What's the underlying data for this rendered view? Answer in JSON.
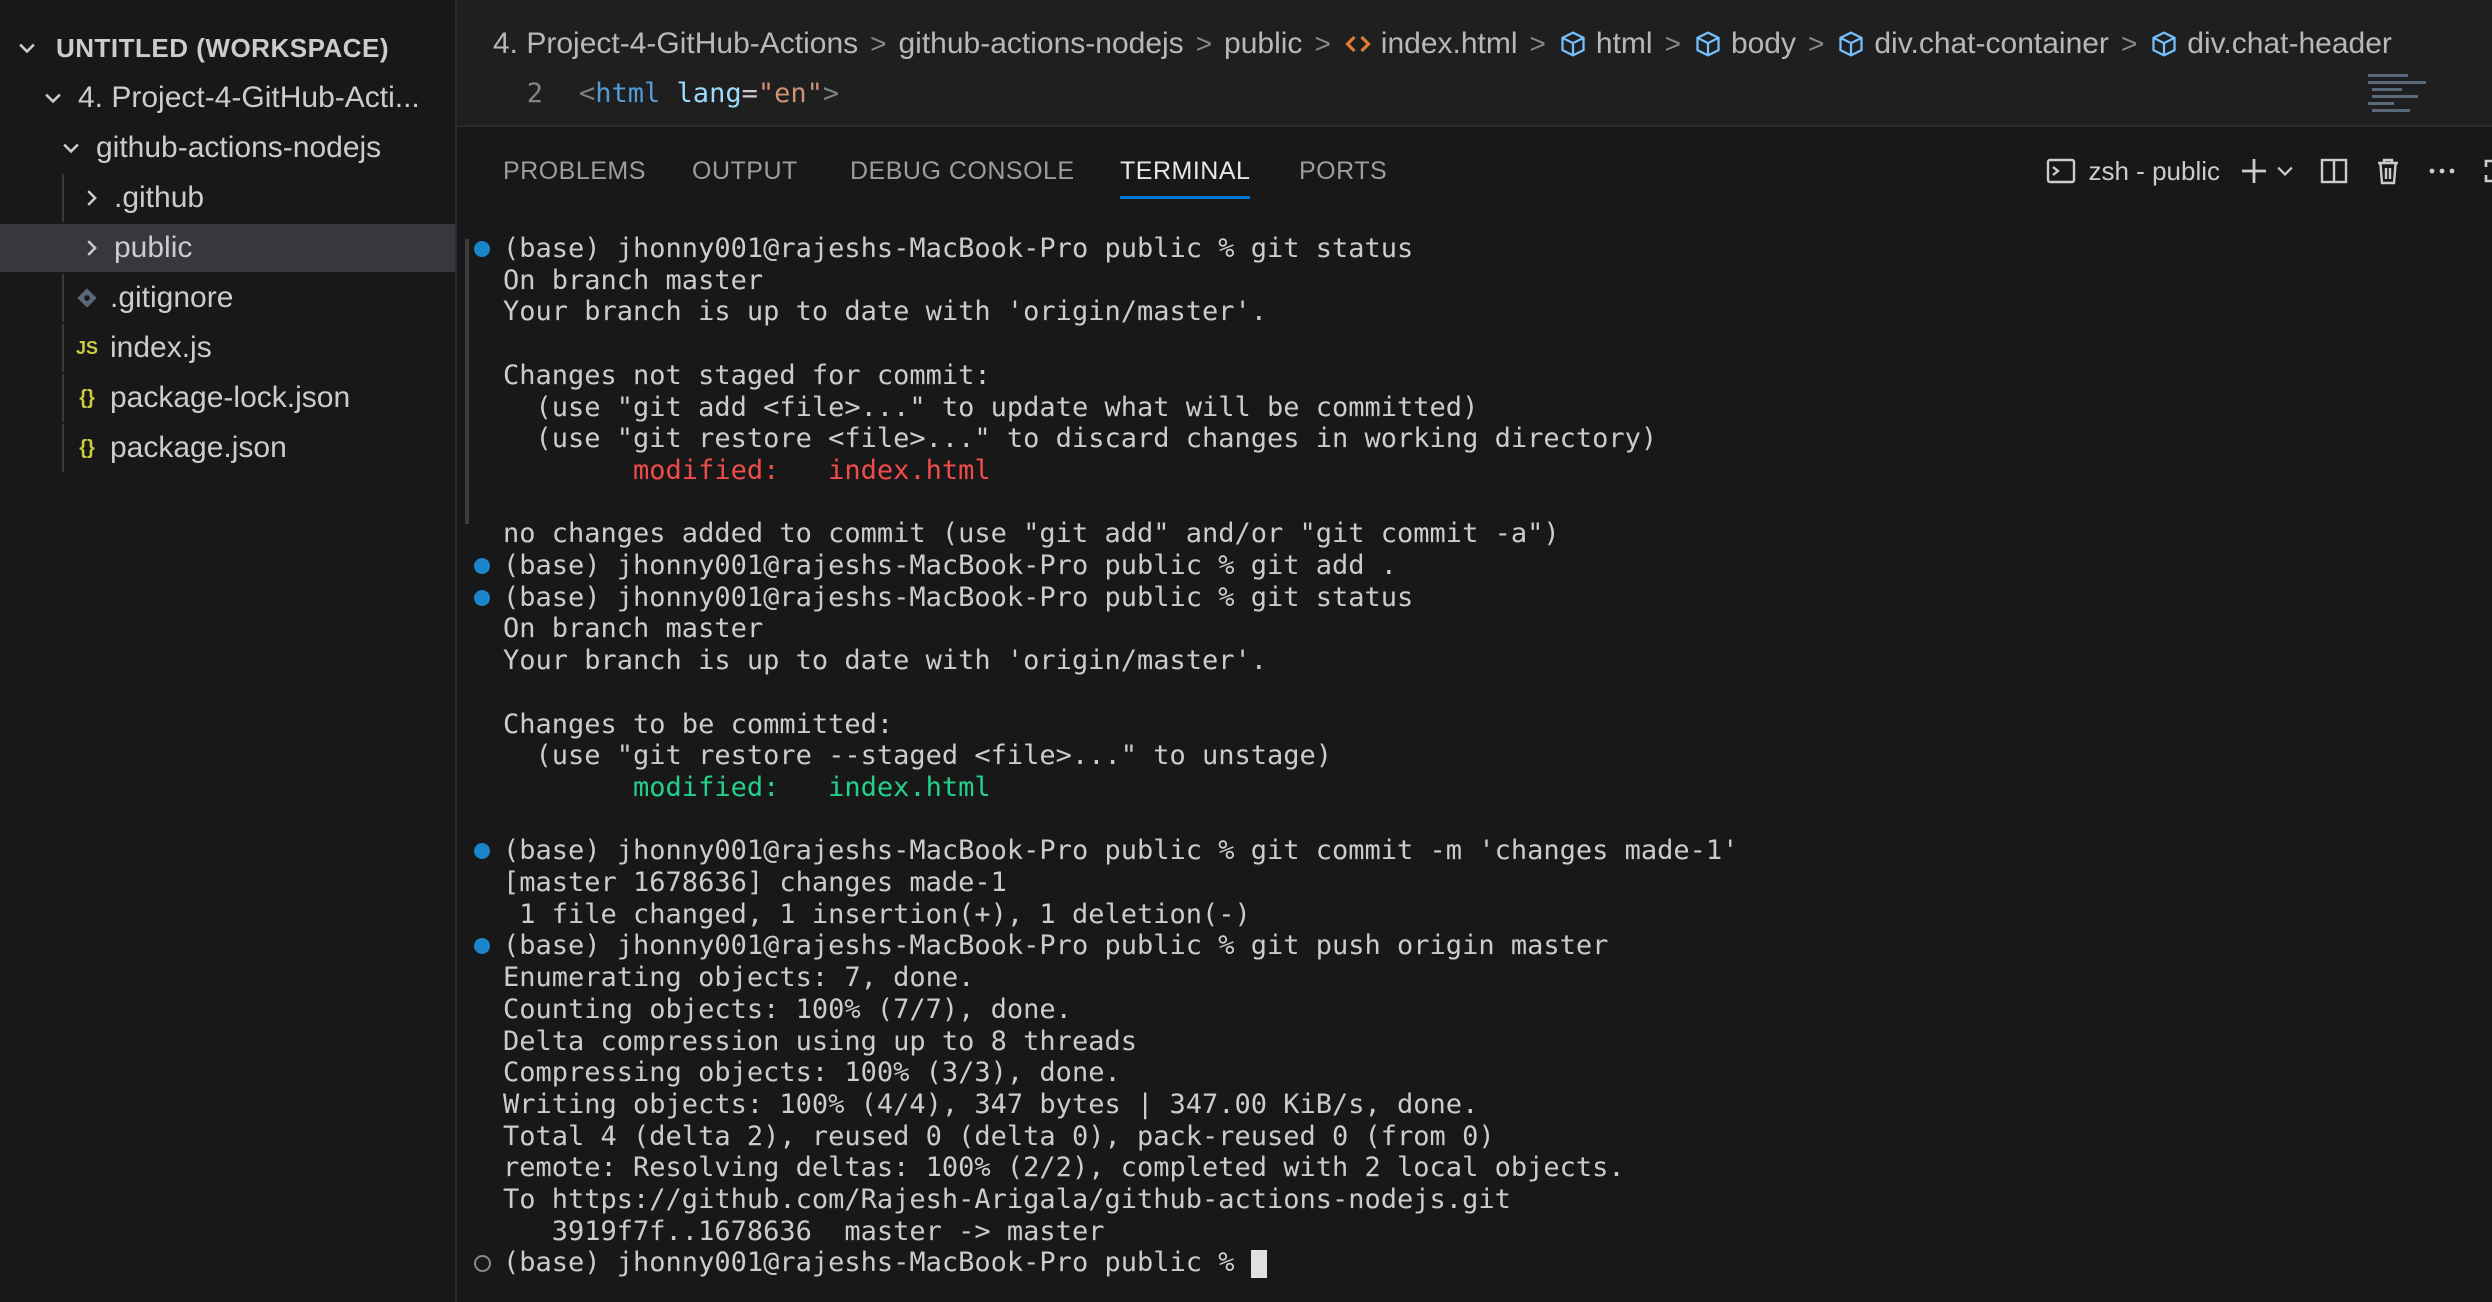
{
  "sidebar": {
    "workspace_title": "UNTITLED (WORKSPACE)",
    "project_folder": "4. Project-4-GitHub-Acti...",
    "subfolder": "github-actions-nodejs",
    "items": [
      {
        "label": ".github",
        "type": "folder"
      },
      {
        "label": "public",
        "type": "folder"
      },
      {
        "label": ".gitignore",
        "type": "git"
      },
      {
        "label": "index.js",
        "type": "js",
        "icon_text": "JS"
      },
      {
        "label": "package-lock.json",
        "type": "json",
        "icon_text": "{}"
      },
      {
        "label": "package.json",
        "type": "json",
        "icon_text": "{}"
      }
    ]
  },
  "breadcrumb": {
    "items": [
      "4. Project-4-GitHub-Actions",
      "github-actions-nodejs",
      "public",
      "index.html",
      "html",
      "body",
      "div.chat-container",
      "div.chat-header"
    ],
    "separator": ">"
  },
  "editor": {
    "line_number": "2",
    "open_bracket": "<",
    "tag": "html",
    "attr": " lang",
    "eq": "=",
    "value": "\"en\"",
    "close_bracket": ">"
  },
  "panel": {
    "tabs": [
      "PROBLEMS",
      "OUTPUT",
      "DEBUG CONSOLE",
      "TERMINAL",
      "PORTS"
    ],
    "active_tab": "TERMINAL",
    "terminal_name": "zsh - public"
  },
  "terminal": {
    "lines": [
      "(base) jhonny001@rajeshs-MacBook-Pro public % git status",
      "On branch master",
      "Your branch is up to date with 'origin/master'.",
      "",
      "Changes not staged for commit:",
      "  (use \"git add <file>...\" to update what will be committed)",
      "  (use \"git restore <file>...\" to discard changes in working directory)",
      "        modified:   index.html",
      "",
      "no changes added to commit (use \"git add\" and/or \"git commit -a\")",
      "(base) jhonny001@rajeshs-MacBook-Pro public % git add .",
      "(base) jhonny001@rajeshs-MacBook-Pro public % git status",
      "On branch master",
      "Your branch is up to date with 'origin/master'.",
      "",
      "Changes to be committed:",
      "  (use \"git restore --staged <file>...\" to unstage)",
      "        modified:   index.html",
      "",
      "(base) jhonny001@rajeshs-MacBook-Pro public % git commit -m 'changes made-1'",
      "[master 1678636] changes made-1",
      " 1 file changed, 1 insertion(+), 1 deletion(-)",
      "(base) jhonny001@rajeshs-MacBook-Pro public % git push origin master",
      "Enumerating objects: 7, done.",
      "Counting objects: 100% (7/7), done.",
      "Delta compression using up to 8 threads",
      "Compressing objects: 100% (3/3), done.",
      "Writing objects: 100% (4/4), 347 bytes | 347.00 KiB/s, done.",
      "Total 4 (delta 2), reused 0 (delta 0), pack-reused 0 (from 0)",
      "remote: Resolving deltas: 100% (2/2), completed with 2 local objects.",
      "To https://github.com/Rajesh-Arigala/github-actions-nodejs.git",
      "   3919f7f..1678636  master -> master",
      "(base) jhonny001@rajeshs-MacBook-Pro public % "
    ],
    "red_lines": [
      7
    ],
    "green_lines": [
      17
    ],
    "filled_dot_lines": [
      0,
      10,
      11,
      19,
      22
    ],
    "hollow_dot_lines": [
      32
    ],
    "cursor_line": 32
  },
  "colors": {
    "accent": "#0078d4",
    "modified_unstaged": "#f14c4c",
    "modified_staged": "#23d18b",
    "command_dot": "#1a85c8"
  }
}
